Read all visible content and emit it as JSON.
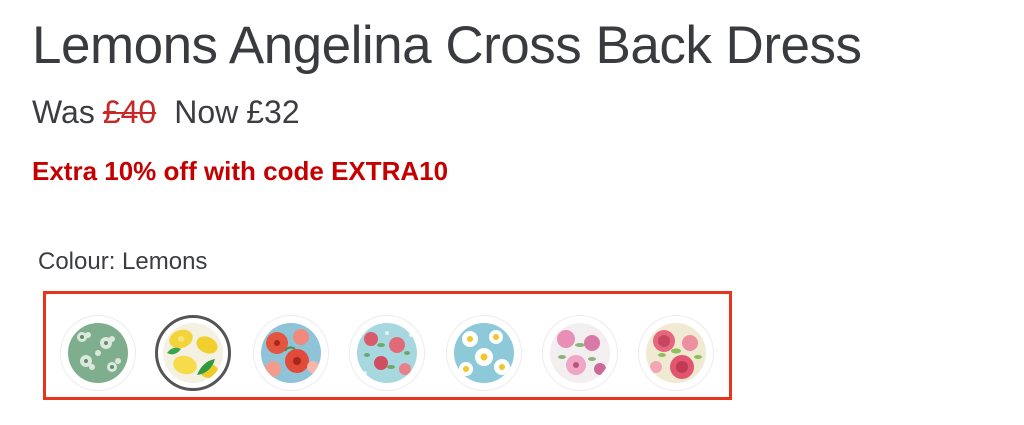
{
  "product": {
    "title": "Lemons Angelina Cross Back Dress"
  },
  "price": {
    "was_label": "Was",
    "was_value": "£40",
    "now_label": "Now",
    "now_value": "£32"
  },
  "promo": {
    "text": "Extra 10% off with code EXTRA10",
    "color": "#c40000"
  },
  "colour": {
    "label": "Colour: Lemons",
    "selected_index": 1,
    "highlight_color": "#e8341d",
    "swatches": [
      {
        "name": "green-floral"
      },
      {
        "name": "lemons"
      },
      {
        "name": "red-floral"
      },
      {
        "name": "blue-rose-floral"
      },
      {
        "name": "blue-daisy"
      },
      {
        "name": "pink-floral"
      },
      {
        "name": "pink-rose-cream"
      }
    ]
  }
}
